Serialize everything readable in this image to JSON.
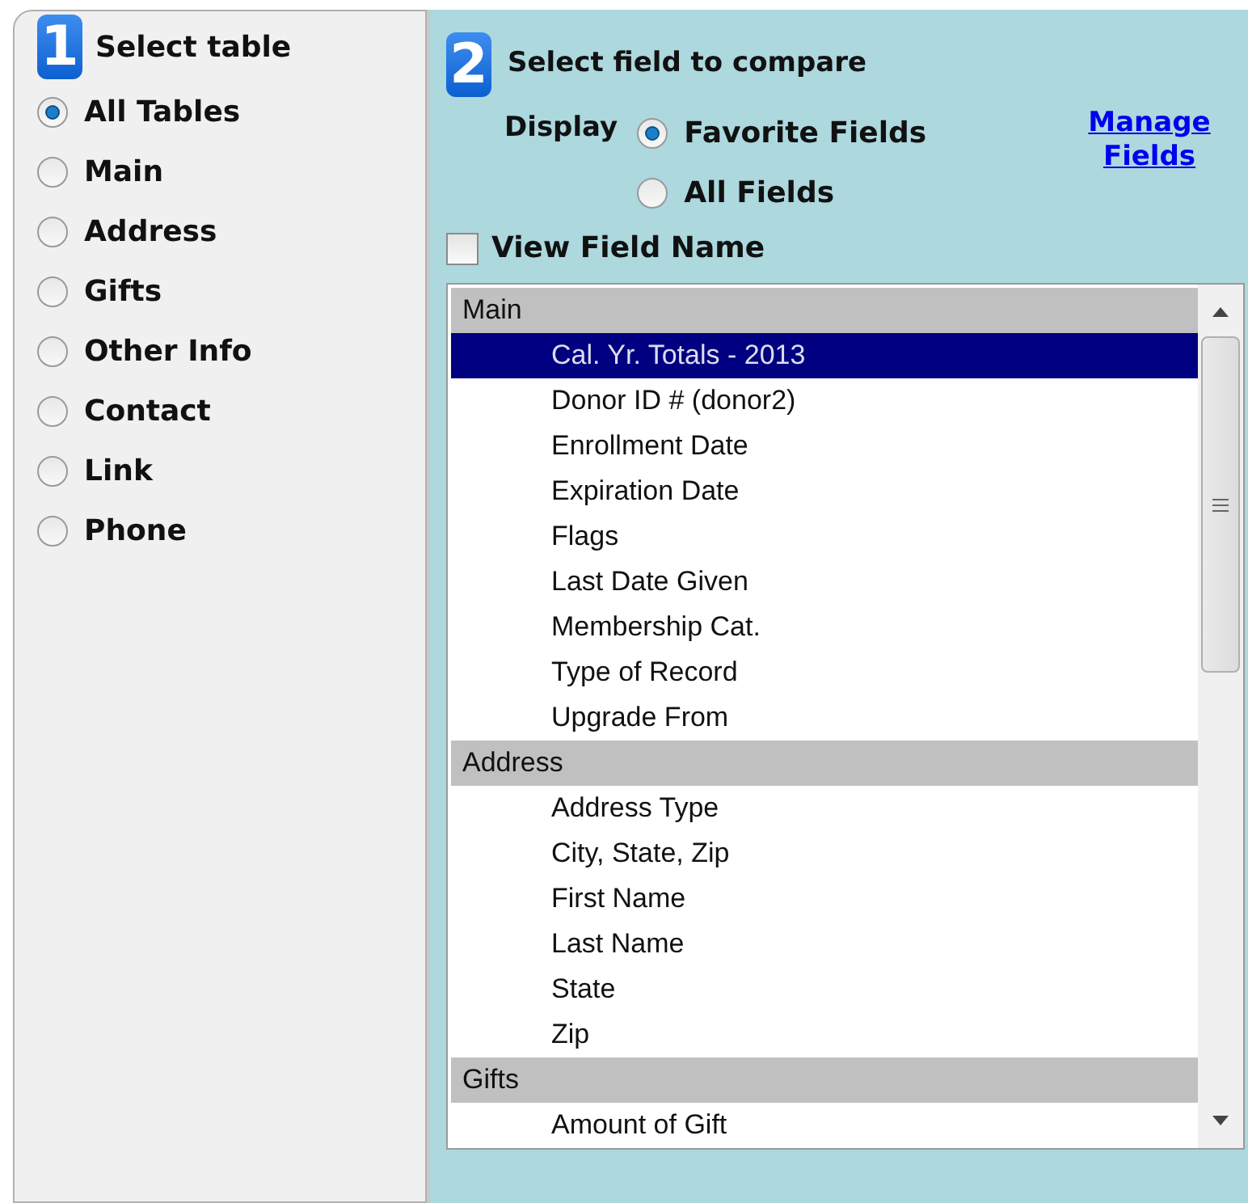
{
  "table_panel": {
    "step": "1",
    "title": "Select table",
    "options": [
      {
        "label": "All Tables",
        "selected": true
      },
      {
        "label": "Main",
        "selected": false
      },
      {
        "label": "Address",
        "selected": false
      },
      {
        "label": "Gifts",
        "selected": false
      },
      {
        "label": "Other Info",
        "selected": false
      },
      {
        "label": "Contact",
        "selected": false
      },
      {
        "label": "Link",
        "selected": false
      },
      {
        "label": "Phone",
        "selected": false
      }
    ]
  },
  "field_panel": {
    "step": "2",
    "title": "Select field to compare",
    "display_label": "Display",
    "display_options": [
      {
        "label": "Favorite Fields",
        "selected": true
      },
      {
        "label": "All Fields",
        "selected": false
      }
    ],
    "manage_link": "Manage Fields",
    "view_field_name": {
      "label": "View Field Name",
      "checked": false
    },
    "field_list": [
      {
        "label": "Main",
        "children": [
          {
            "label": "Cal. Yr. Totals - 2013",
            "selected": true
          },
          {
            "label": "Donor ID # (donor2)",
            "selected": false
          },
          {
            "label": "Enrollment Date",
            "selected": false
          },
          {
            "label": "Expiration Date",
            "selected": false
          },
          {
            "label": "Flags",
            "selected": false
          },
          {
            "label": "Last Date Given",
            "selected": false
          },
          {
            "label": "Membership Cat.",
            "selected": false
          },
          {
            "label": "Type of Record",
            "selected": false
          },
          {
            "label": "Upgrade From",
            "selected": false
          }
        ]
      },
      {
        "label": "Address",
        "children": [
          {
            "label": "Address Type",
            "selected": false
          },
          {
            "label": "City, State, Zip",
            "selected": false
          },
          {
            "label": "First Name",
            "selected": false
          },
          {
            "label": "Last Name",
            "selected": false
          },
          {
            "label": "State",
            "selected": false
          },
          {
            "label": "Zip",
            "selected": false
          }
        ]
      },
      {
        "label": "Gifts",
        "children": [
          {
            "label": "Amount of Gift",
            "selected": false
          }
        ]
      }
    ]
  }
}
